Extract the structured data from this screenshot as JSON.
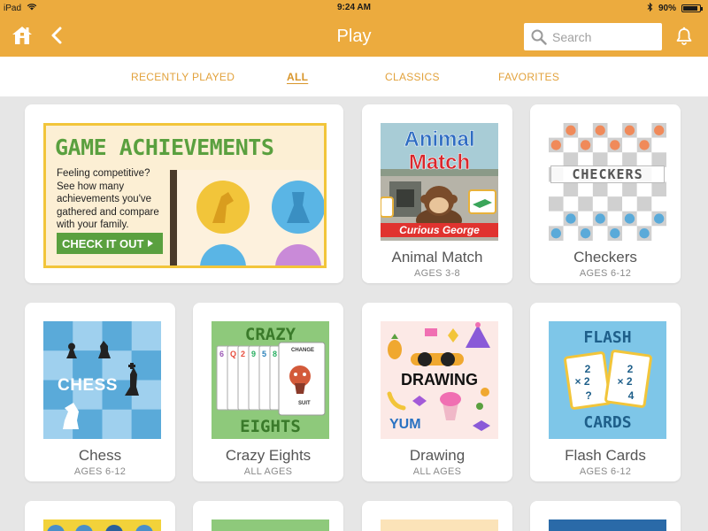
{
  "status_bar": {
    "device": "iPad",
    "time": "9:24 AM",
    "battery": "90%",
    "battery_level": 0.9
  },
  "header": {
    "title": "Play",
    "search_placeholder": "Search"
  },
  "tabs": [
    {
      "label": "RECENTLY PLAYED",
      "active": false
    },
    {
      "label": "ALL",
      "active": true
    },
    {
      "label": "CLASSICS",
      "active": false
    },
    {
      "label": "FAVORITES",
      "active": false
    }
  ],
  "banner": {
    "heading": "GAME ACHIEVEMENTS",
    "body": "Feeling competitive? See how many achievements you've gathered and compare with your family.",
    "cta": "CHECK IT OUT"
  },
  "games": [
    {
      "title": "Animal Match",
      "ages": "AGES 3-8",
      "thumb_line1": "Animal",
      "thumb_line2": "Match",
      "thumb_logo": "Curious George"
    },
    {
      "title": "Checkers",
      "ages": "AGES 6-12",
      "thumb_text": "CHECKERS"
    },
    {
      "title": "Chess",
      "ages": "AGES 6-12",
      "thumb_text": "CHESS"
    },
    {
      "title": "Crazy Eights",
      "ages": "ALL AGES",
      "thumb_line1": "CRAZY",
      "thumb_line2": "EIGHTS",
      "card_change": "CHANGE",
      "card_suit": "SUIT"
    },
    {
      "title": "Drawing",
      "ages": "ALL AGES",
      "thumb_text": "DRAWING",
      "thumb_yum": "YUM"
    },
    {
      "title": "Flash Cards",
      "ages": "AGES 6-12",
      "thumb_line1": "FLASH",
      "thumb_line2": "CARDS"
    }
  ],
  "colors": {
    "header": "#ecab3e",
    "tab_text": "#e2a23c",
    "banner_green": "#5a9e3f",
    "background": "#e6e6e6"
  }
}
